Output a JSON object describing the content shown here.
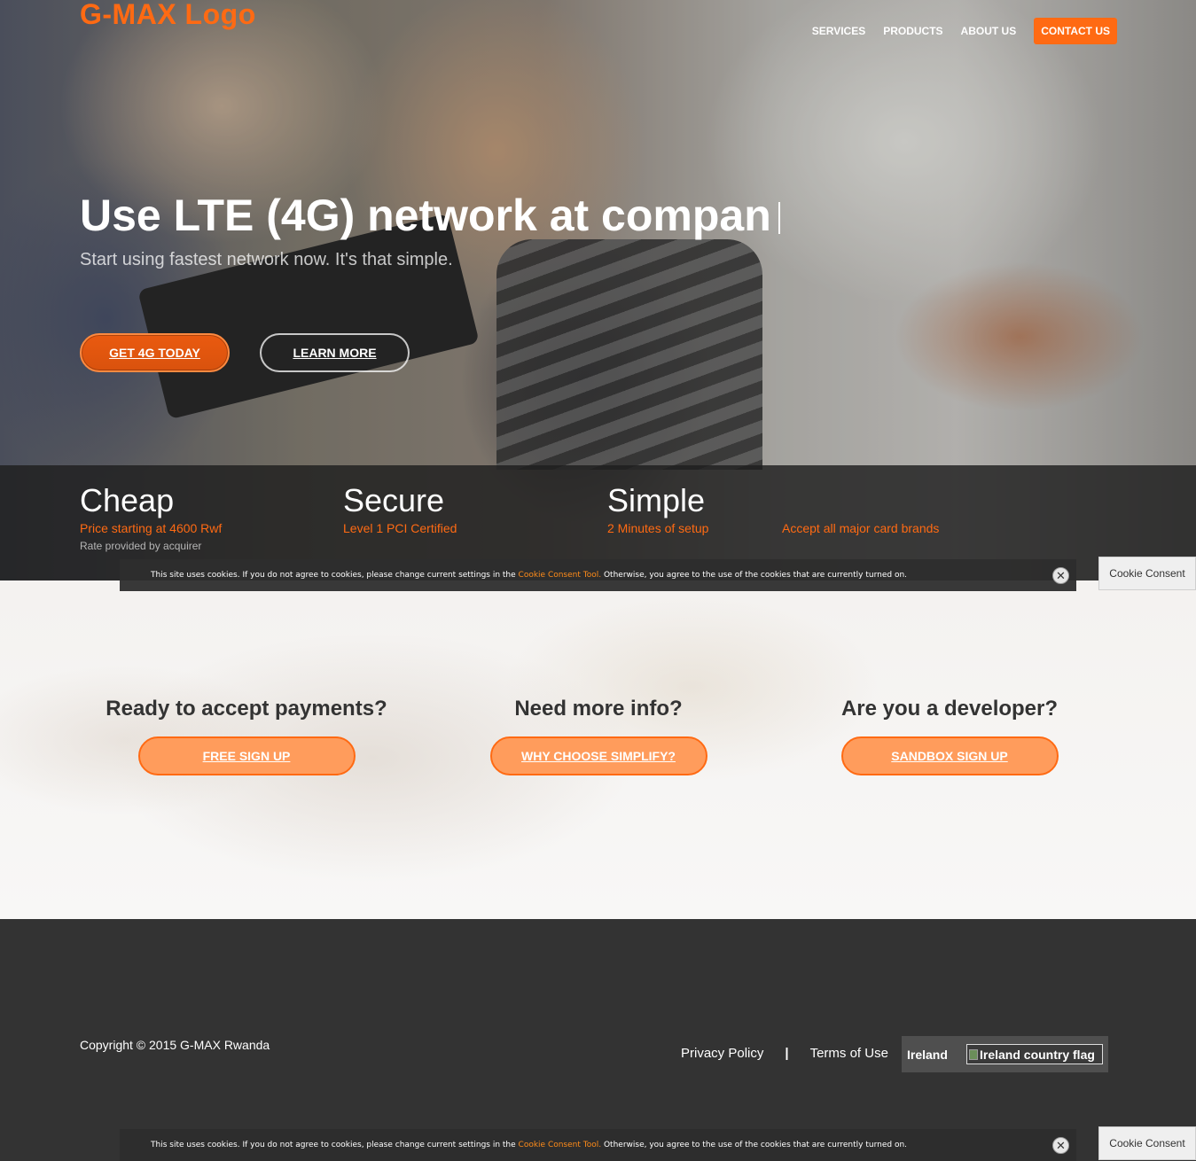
{
  "brand": {
    "logo_text": "G-MAX Logo",
    "accent_color": "#ff6a13"
  },
  "nav": {
    "items": [
      "SERVICES",
      "PRODUCTS",
      "ABOUT US"
    ],
    "contact": "CONTACT US"
  },
  "hero": {
    "headline": "Use LTE (4G) network at compan",
    "subhead": "Start using fastest network now. It's that simple.",
    "primary_button": "GET 4G TODAY",
    "secondary_button": "LEARN MORE"
  },
  "features": [
    {
      "title": "Cheap",
      "desc": "Price starting at 4600 Rwf",
      "note": "Rate provided by acquirer"
    },
    {
      "title": "Secure",
      "desc": "Level 1 PCI Certified"
    },
    {
      "title": "Simple",
      "desc": "2 Minutes of setup"
    },
    {
      "title": "",
      "desc": "Accept all major card brands"
    }
  ],
  "cookie": {
    "text_before": "This site uses cookies. If you do not agree to cookies, please change current settings in the ",
    "link": "Cookie Consent Tool.",
    "text_after": " Otherwise, you agree to the use of the cookies that are currently turned on.",
    "tab_label": "Cookie Consent",
    "close_glyph": "✕"
  },
  "cta": [
    {
      "heading": "Ready to accept payments?",
      "button": "FREE SIGN UP"
    },
    {
      "heading": "Need more info?",
      "button": "WHY CHOOSE SIMPLIFY?"
    },
    {
      "heading": "Are you a developer?",
      "button": "SANDBOX SIGN UP"
    }
  ],
  "footer": {
    "copyright": "Copyright © 2015 G-MAX Rwanda",
    "privacy": "Privacy Policy",
    "separator": "|",
    "terms": "Terms of Use",
    "country": "Ireland",
    "flag_alt": "Ireland country flag"
  }
}
